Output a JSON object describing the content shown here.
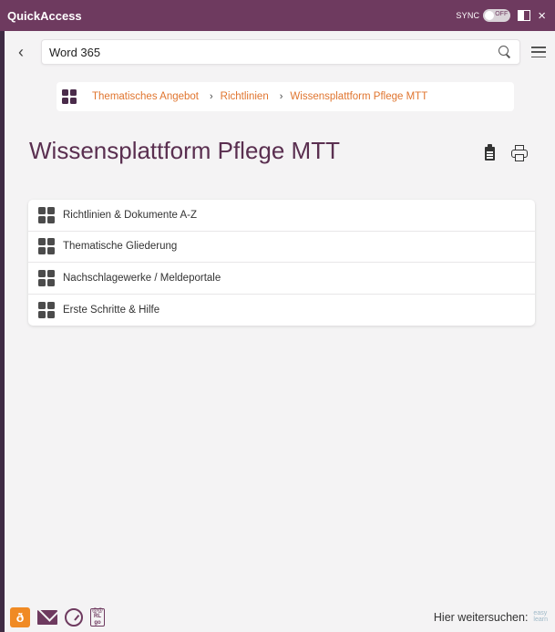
{
  "titlebar": {
    "title": "QuickAccess",
    "sync_label": "SYNC",
    "sync_toggle_state": "OFF",
    "close_glyph": "×"
  },
  "search": {
    "back_glyph": "‹",
    "value": "Word 365",
    "placeholder": ""
  },
  "breadcrumb": {
    "items": [
      "Thematisches Angebot",
      "Richtlinien",
      "Wissensplattform Pflege MTT"
    ],
    "separator": "›"
  },
  "page": {
    "title": "Wissensplattform Pflege MTT"
  },
  "menu": {
    "items": [
      {
        "label": "Richtlinien & Dokumente A-Z"
      },
      {
        "label": "Thematische Gliederung"
      },
      {
        "label": "Nachschlagewerke / Meldeportale"
      },
      {
        "label": "Erste Schritte & Hilfe"
      }
    ]
  },
  "footer": {
    "orange_glyph": "ð",
    "rl_top": "@@",
    "rl_mid": "RL",
    "rl_bottom": "go",
    "more_label": "Hier weitersuchen:",
    "logo_line1": "easy",
    "logo_line2": "learn"
  },
  "colors": {
    "titlebar_bg": "#6e3a5f",
    "accent_link": "#e0752f",
    "title_text": "#5a2f50",
    "footer_orange": "#f08a24"
  },
  "icons": [
    "grid-icon",
    "search-icon",
    "menu-icon",
    "clipboard-icon",
    "print-icon",
    "mail-icon",
    "gauge-icon",
    "rl-icon",
    "close-icon",
    "back-icon"
  ]
}
